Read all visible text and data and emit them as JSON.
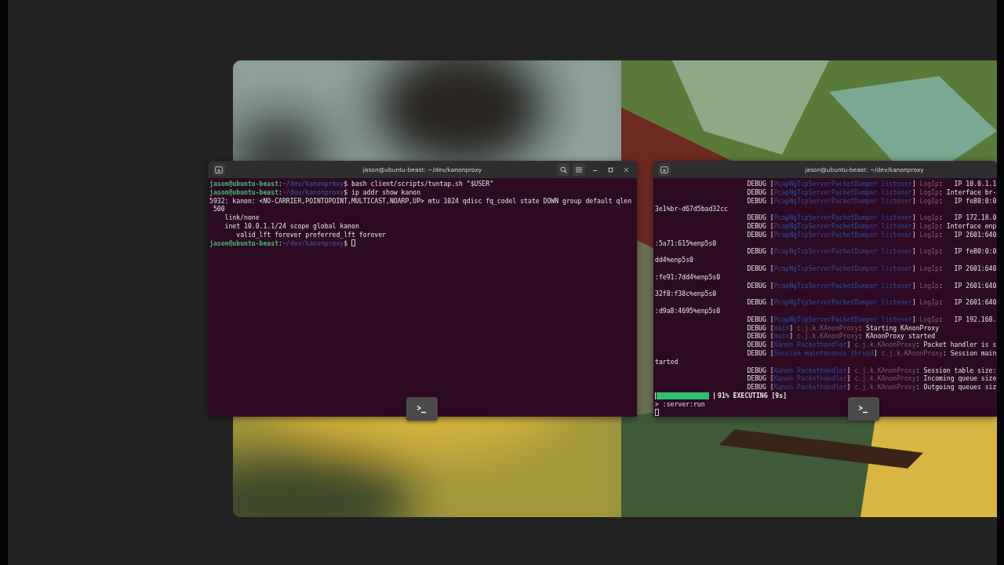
{
  "windows": [
    {
      "title": "jason@ubuntu-beast: ~/dev/kanonproxy",
      "controls": true,
      "lines": [
        {
          "kind": "text",
          "segments": [
            {
              "kind": "host",
              "text": "jason@ubuntu-beast"
            },
            {
              "kind": "plain",
              "text": ":"
            },
            {
              "kind": "path",
              "text": "~/dev/kanonproxy"
            },
            {
              "kind": "plain",
              "text": "$ bash client/scripts/tuntap.sh \"$USER\""
            }
          ]
        },
        {
          "kind": "text",
          "segments": [
            {
              "kind": "host",
              "text": "jason@ubuntu-beast"
            },
            {
              "kind": "plain",
              "text": ":"
            },
            {
              "kind": "path",
              "text": "~/dev/kanonproxy"
            },
            {
              "kind": "plain",
              "text": "$ ip addr show kanon"
            }
          ]
        },
        {
          "kind": "text",
          "segments": [
            {
              "kind": "plain",
              "text": "5932: kanon: <NO-CARRIER,POINTOPOINT,MULTICAST,NOARP,UP> mtu 1024 qdisc fq_codel state DOWN group default qlen"
            }
          ]
        },
        {
          "kind": "text",
          "segments": [
            {
              "kind": "plain",
              "text": " 500"
            }
          ]
        },
        {
          "kind": "text",
          "segments": [
            {
              "kind": "plain",
              "text": "    link/none"
            }
          ]
        },
        {
          "kind": "text",
          "segments": [
            {
              "kind": "plain",
              "text": "    inet 10.0.1.1/24 scope global kanon"
            }
          ]
        },
        {
          "kind": "text",
          "segments": [
            {
              "kind": "plain",
              "text": "       valid_lft forever preferred_lft forever"
            }
          ]
        },
        {
          "kind": "text",
          "segments": [
            {
              "kind": "host",
              "text": "jason@ubuntu-beast"
            },
            {
              "kind": "plain",
              "text": ":"
            },
            {
              "kind": "path",
              "text": "~/dev/kanonproxy"
            },
            {
              "kind": "plain",
              "text": "$ "
            },
            {
              "kind": "cursor"
            }
          ]
        }
      ]
    },
    {
      "title": "jason@ubuntu-beast: ~/dev/kanonproxy",
      "controls": false,
      "lines": [
        {
          "kind": "log",
          "segments": [
            {
              "kind": "plain",
              "text": "DEBUG ["
            },
            {
              "kind": "thread",
              "text": "PcapNgTcpServerPacketDumper listener"
            },
            {
              "kind": "plain",
              "text": "] "
            },
            {
              "kind": "logger",
              "text": "LogIp"
            },
            {
              "kind": "plain",
              "text": ":   IP 10.0.1.1"
            }
          ]
        },
        {
          "kind": "log",
          "segments": [
            {
              "kind": "plain",
              "text": "DEBUG ["
            },
            {
              "kind": "thread",
              "text": "PcapNgTcpServerPacketDumper listener"
            },
            {
              "kind": "plain",
              "text": "] "
            },
            {
              "kind": "logger",
              "text": "LogIp"
            },
            {
              "kind": "plain",
              "text": ": Interface br-"
            }
          ]
        },
        {
          "kind": "log",
          "segments": [
            {
              "kind": "plain",
              "text": "DEBUG ["
            },
            {
              "kind": "thread",
              "text": "PcapNgTcpServerPacketDumper listener"
            },
            {
              "kind": "plain",
              "text": "] "
            },
            {
              "kind": "logger",
              "text": "LogIp"
            },
            {
              "kind": "plain",
              "text": ":   IP fe80:0:0"
            }
          ]
        },
        {
          "kind": "text",
          "segments": [
            {
              "kind": "plain",
              "text": "3e1%br-d67d5bad32cc"
            }
          ]
        },
        {
          "kind": "log",
          "segments": [
            {
              "kind": "plain",
              "text": "DEBUG ["
            },
            {
              "kind": "thread",
              "text": "PcapNgTcpServerPacketDumper listener"
            },
            {
              "kind": "plain",
              "text": "] "
            },
            {
              "kind": "logger",
              "text": "LogIp"
            },
            {
              "kind": "plain",
              "text": ":   IP 172.18.0"
            }
          ]
        },
        {
          "kind": "log",
          "segments": [
            {
              "kind": "plain",
              "text": "DEBUG ["
            },
            {
              "kind": "thread",
              "text": "PcapNgTcpServerPacketDumper listener"
            },
            {
              "kind": "plain",
              "text": "] "
            },
            {
              "kind": "logger",
              "text": "LogIp"
            },
            {
              "kind": "plain",
              "text": ": Interface enp"
            }
          ]
        },
        {
          "kind": "log",
          "segments": [
            {
              "kind": "plain",
              "text": "DEBUG ["
            },
            {
              "kind": "thread",
              "text": "PcapNgTcpServerPacketDumper listener"
            },
            {
              "kind": "plain",
              "text": "] "
            },
            {
              "kind": "logger",
              "text": "LogIp"
            },
            {
              "kind": "plain",
              "text": ":   IP 2601:640"
            }
          ]
        },
        {
          "kind": "text",
          "segments": [
            {
              "kind": "plain",
              "text": ":5a71:615%enp5s0"
            }
          ]
        },
        {
          "kind": "log",
          "segments": [
            {
              "kind": "plain",
              "text": "DEBUG ["
            },
            {
              "kind": "thread",
              "text": "PcapNgTcpServerPacketDumper listener"
            },
            {
              "kind": "plain",
              "text": "] "
            },
            {
              "kind": "logger",
              "text": "LogIp"
            },
            {
              "kind": "plain",
              "text": ":   IP fe80:0:0"
            }
          ]
        },
        {
          "kind": "text",
          "segments": [
            {
              "kind": "plain",
              "text": "dd4%enp5s0"
            }
          ]
        },
        {
          "kind": "log",
          "segments": [
            {
              "kind": "plain",
              "text": "DEBUG ["
            },
            {
              "kind": "thread",
              "text": "PcapNgTcpServerPacketDumper listener"
            },
            {
              "kind": "plain",
              "text": "] "
            },
            {
              "kind": "logger",
              "text": "LogIp"
            },
            {
              "kind": "plain",
              "text": ":   IP 2601:640"
            }
          ]
        },
        {
          "kind": "text",
          "segments": [
            {
              "kind": "plain",
              "text": ":fe91:7dd4%enp5s0"
            }
          ]
        },
        {
          "kind": "log",
          "segments": [
            {
              "kind": "plain",
              "text": "DEBUG ["
            },
            {
              "kind": "thread",
              "text": "PcapNgTcpServerPacketDumper listener"
            },
            {
              "kind": "plain",
              "text": "] "
            },
            {
              "kind": "logger",
              "text": "LogIp"
            },
            {
              "kind": "plain",
              "text": ":   IP 2601:640"
            }
          ]
        },
        {
          "kind": "text",
          "segments": [
            {
              "kind": "plain",
              "text": "32f8:f38c%enp5s0"
            }
          ]
        },
        {
          "kind": "log",
          "segments": [
            {
              "kind": "plain",
              "text": "DEBUG ["
            },
            {
              "kind": "thread",
              "text": "PcapNgTcpServerPacketDumper listener"
            },
            {
              "kind": "plain",
              "text": "] "
            },
            {
              "kind": "logger",
              "text": "LogIp"
            },
            {
              "kind": "plain",
              "text": ":   IP 2601:640"
            }
          ]
        },
        {
          "kind": "text",
          "segments": [
            {
              "kind": "plain",
              "text": ":d9a8:4695%enp5s0"
            }
          ]
        },
        {
          "kind": "log",
          "segments": [
            {
              "kind": "plain",
              "text": "DEBUG ["
            },
            {
              "kind": "thread",
              "text": "PcapNgTcpServerPacketDumper listener"
            },
            {
              "kind": "plain",
              "text": "] "
            },
            {
              "kind": "logger",
              "text": "LogIp"
            },
            {
              "kind": "plain",
              "text": ":   IP 192.168."
            }
          ]
        },
        {
          "kind": "log",
          "segments": [
            {
              "kind": "plain",
              "text": "DEBUG ["
            },
            {
              "kind": "thread",
              "text": "main"
            },
            {
              "kind": "plain",
              "text": "] "
            },
            {
              "kind": "logger",
              "text": "c.j.k.KAnonProxy"
            },
            {
              "kind": "plain",
              "text": ": Starting KAnonProxy"
            }
          ]
        },
        {
          "kind": "log",
          "segments": [
            {
              "kind": "plain",
              "text": "DEBUG ["
            },
            {
              "kind": "thread",
              "text": "main"
            },
            {
              "kind": "plain",
              "text": "] "
            },
            {
              "kind": "logger",
              "text": "c.j.k.KAnonProxy"
            },
            {
              "kind": "plain",
              "text": ": KAnonProxy started"
            }
          ]
        },
        {
          "kind": "log",
          "segments": [
            {
              "kind": "plain",
              "text": "DEBUG ["
            },
            {
              "kind": "thread",
              "text": "Kanon Packethandler"
            },
            {
              "kind": "plain",
              "text": "] "
            },
            {
              "kind": "logger",
              "text": "c.j.k.KAnonProxy"
            },
            {
              "kind": "plain",
              "text": ": Packet handler is s"
            }
          ]
        },
        {
          "kind": "log",
          "segments": [
            {
              "kind": "plain",
              "text": "DEBUG ["
            },
            {
              "kind": "thread",
              "text": "Session maintenance thread"
            },
            {
              "kind": "plain",
              "text": "] "
            },
            {
              "kind": "logger",
              "text": "c.j.k.KAnonProxy"
            },
            {
              "kind": "plain",
              "text": ": Session main"
            }
          ]
        },
        {
          "kind": "text",
          "segments": [
            {
              "kind": "plain",
              "text": "tarted"
            }
          ]
        },
        {
          "kind": "log",
          "segments": [
            {
              "kind": "plain",
              "text": "DEBUG ["
            },
            {
              "kind": "thread",
              "text": "Kanon Packethandler"
            },
            {
              "kind": "plain",
              "text": "] "
            },
            {
              "kind": "logger",
              "text": "c.j.k.KAnonProxy"
            },
            {
              "kind": "plain",
              "text": ": Session table size:"
            }
          ]
        },
        {
          "kind": "log",
          "segments": [
            {
              "kind": "plain",
              "text": "DEBUG ["
            },
            {
              "kind": "thread",
              "text": "Kanon Packethandler"
            },
            {
              "kind": "plain",
              "text": "] "
            },
            {
              "kind": "logger",
              "text": "c.j.k.KAnonProxy"
            },
            {
              "kind": "plain",
              "text": ": Incoming queue size"
            }
          ]
        },
        {
          "kind": "log",
          "segments": [
            {
              "kind": "plain",
              "text": "DEBUG ["
            },
            {
              "kind": "thread",
              "text": "Kanon Packethandler"
            },
            {
              "kind": "plain",
              "text": "] "
            },
            {
              "kind": "logger",
              "text": "c.j.k.KAnonProxy"
            },
            {
              "kind": "plain",
              "text": ": Outgoing queues siz"
            }
          ]
        },
        {
          "kind": "progress",
          "level": 0.93,
          "text": "91% EXECUTING [9s]"
        },
        {
          "kind": "text",
          "segments": [
            {
              "kind": "plain",
              "text": "> :server:run"
            }
          ]
        },
        {
          "kind": "text",
          "segments": [
            {
              "kind": "cursor"
            }
          ]
        }
      ]
    }
  ]
}
